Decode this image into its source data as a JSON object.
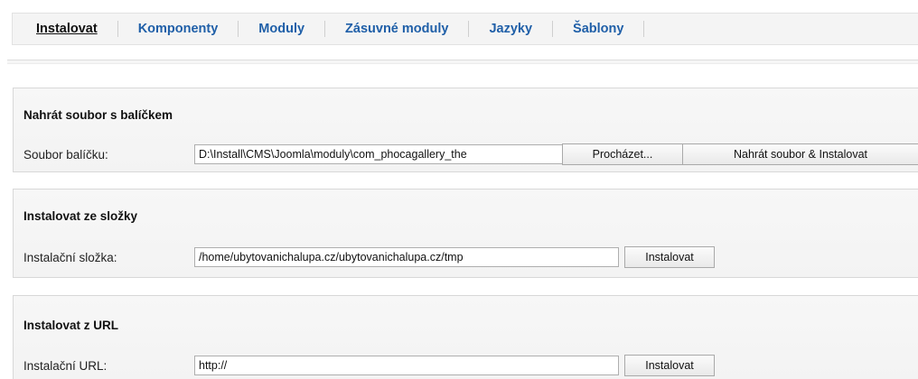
{
  "tabs": [
    "Instalovat",
    "Komponenty",
    "Moduly",
    "Zásuvné moduly",
    "Jazyky",
    "Šablony"
  ],
  "upload": {
    "title": "Nahrát soubor s balíčkem",
    "label": "Soubor balíčku:",
    "file_value": "D:\\Install\\CMS\\Joomla\\moduly\\com_phocagallery_the",
    "browse_label": "Procházet...",
    "submit_label": "Nahrát soubor & Instalovat"
  },
  "folder": {
    "title": "Instalovat ze složky",
    "label": "Instalační složka:",
    "value": "/home/ubytovanichalupa.cz/ubytovanichalupa.cz/tmp",
    "submit_label": "Instalovat"
  },
  "url": {
    "title": "Instalovat z URL",
    "label": "Instalační URL:",
    "value": "http://",
    "submit_label": "Instalovat"
  }
}
